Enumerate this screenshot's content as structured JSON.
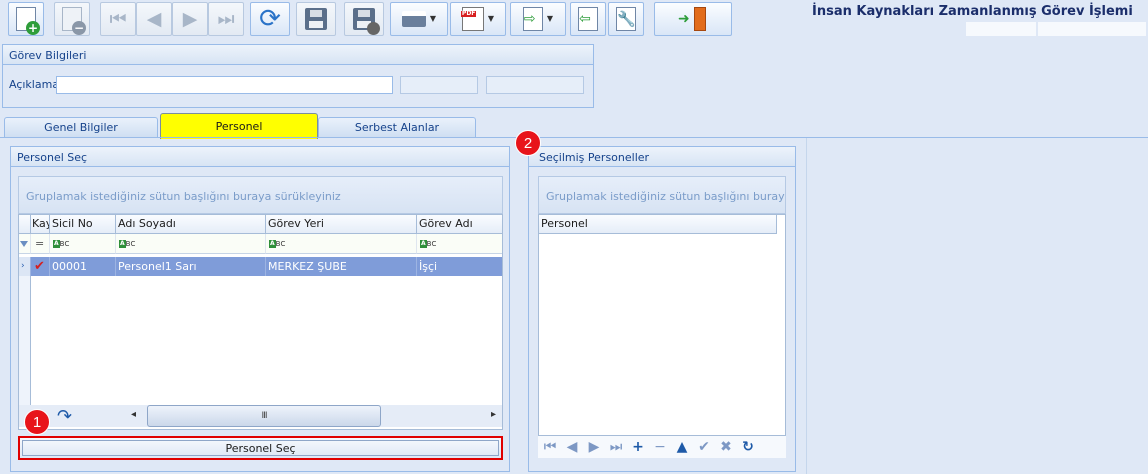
{
  "window": {
    "title": "İnsan Kaynakları Zamanlanmış Görev İşlemi"
  },
  "toolbar": {
    "icons": [
      "new-document-icon",
      "delete-document-icon",
      "first-record-icon",
      "previous-record-icon",
      "next-record-icon",
      "last-record-icon",
      "refresh-icon",
      "save-icon",
      "save-and-close-icon",
      "print-icon",
      "pdf-export-icon",
      "export-icon",
      "import-icon",
      "settings-wrench-icon",
      "exit-door-icon"
    ],
    "pdf_label": "PDF"
  },
  "gorev_bilgileri": {
    "header": "Görev Bilgileri",
    "aciklama_label": "Açıklama",
    "aciklama_value": ""
  },
  "tabs": [
    {
      "label": "Genel Bilgiler"
    },
    {
      "label": "Personel"
    },
    {
      "label": "Serbest Alanlar"
    }
  ],
  "personel_sec": {
    "header": "Personel Seç",
    "group_hint": "Gruplamak istediğiniz sütun başlığını buraya sürükleyiniz",
    "columns": [
      "Kay",
      "Sicil No",
      "Adı Soyadı",
      "Görev Yeri",
      "Görev Adı"
    ],
    "filter_eq": "=",
    "abc_a": "A",
    "abc_b": "B",
    "abc_c": "C",
    "rows": [
      {
        "sicil_no": "00001",
        "adi_soyadi": "Personel1 Sarı",
        "gorev_yeri": "MERKEZ ŞUBE",
        "gorev_adi": "İşçi"
      }
    ],
    "scroll_left": "◂",
    "scroll_right": "▸",
    "scroll_grip": "III",
    "select_button": "Personel Seç"
  },
  "secilmis": {
    "header": "Seçilmiş Personeller",
    "group_hint": "Gruplamak istediğiniz sütun başlığını buraya sürükleyiniz",
    "columns": [
      "Personel"
    ],
    "nav": {
      "first": "⏮",
      "prev": "◀",
      "next": "▶",
      "last": "⏭",
      "add": "+",
      "remove": "−",
      "up": "▲",
      "apply": "✔",
      "cancel": "✖",
      "refresh": "↻"
    }
  },
  "markers": [
    "1",
    "2"
  ],
  "colors": {
    "accent": "#15428b",
    "selected_row": "#7f9cd9",
    "active_tab": "#ffff00",
    "marker": "#e8141a"
  }
}
